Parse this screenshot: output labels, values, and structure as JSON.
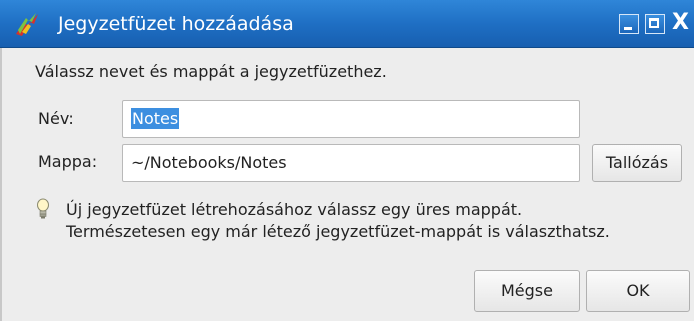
{
  "window": {
    "title": "Jegyzetfüzet hozzáadása",
    "icon": "app-logo-icon",
    "controls": [
      "minimize-icon",
      "maximize-icon",
      "close-icon"
    ],
    "close_glyph": "X"
  },
  "dialog": {
    "instruction": "Válassz nevet és mappát a jegyzetfüzethez.",
    "name_label": "Név:",
    "name_value": "Notes",
    "folder_label": "Mappa:",
    "folder_value": "~/Notebooks/Notes",
    "browse_label": "Tallózás",
    "hint_icon": "lightbulb-icon",
    "hint_line1": "Új jegyzetfüzet létrehozásához válassz egy üres mappát.",
    "hint_line2": "Természetesen egy már létező jegyzetfüzet-mappát is választhatsz.",
    "cancel_label": "Mégse",
    "ok_label": "OK"
  },
  "colors": {
    "titlebar": "#1f6fc4",
    "selection": "#3d8fe0",
    "background": "#ededed"
  }
}
